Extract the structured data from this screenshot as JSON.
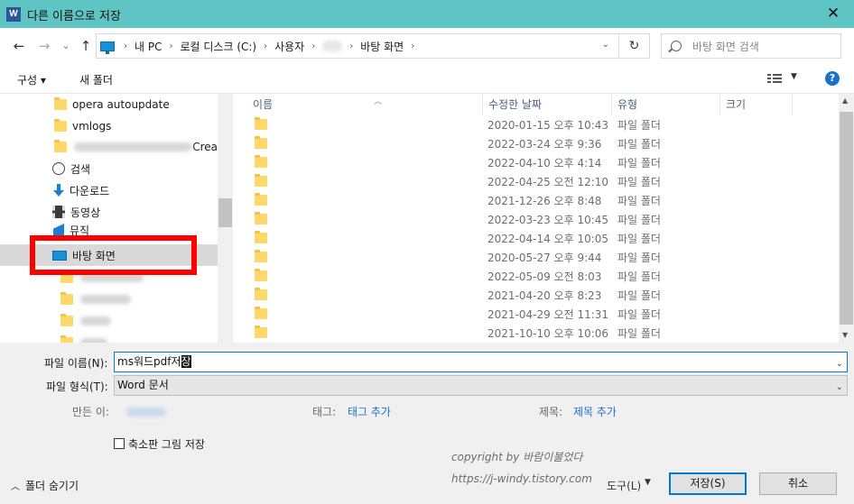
{
  "window": {
    "title": "다른 이름으로 저장",
    "app_icon": "W",
    "close": "✕"
  },
  "nav": {
    "back": "←",
    "forward": "→",
    "recent": "⌄",
    "up": "↑",
    "breadcrumbs": [
      "내 PC",
      "로컬 디스크 (C:)",
      "사용자",
      "바탕 화면"
    ],
    "refresh": "↻",
    "search_placeholder": "바탕 화면 검색"
  },
  "toolbar": {
    "organize": "구성 ▾",
    "new_folder": "새 폴더",
    "help": "?"
  },
  "tree": {
    "items": [
      {
        "label": "opera autoupdate",
        "icon": "folder-icon"
      },
      {
        "label": "vmlogs",
        "icon": "folder-icon"
      },
      {
        "label": "Crea",
        "icon": "folder-icon"
      },
      {
        "label": "검색",
        "icon": "search-icon"
      },
      {
        "label": "다운로드",
        "icon": "download-icon"
      },
      {
        "label": "동영상",
        "icon": "video-icon"
      },
      {
        "label": "뮤직",
        "icon": "music-icon"
      },
      {
        "label": "바탕 화면",
        "icon": "desktop-icon",
        "selected": true
      }
    ]
  },
  "filelist": {
    "columns": [
      "이름",
      "수정한 날짜",
      "유형",
      "크기"
    ],
    "rows": [
      {
        "date": "2020-01-15 오후 10:43",
        "type": "파일 폴더"
      },
      {
        "date": "2022-03-24 오후 9:36",
        "type": "파일 폴더"
      },
      {
        "date": "2022-04-10 오후 4:14",
        "type": "파일 폴더"
      },
      {
        "date": "2022-04-25 오전 12:10",
        "type": "파일 폴더"
      },
      {
        "date": "2021-12-26 오후 8:48",
        "type": "파일 폴더"
      },
      {
        "date": "2022-03-23 오후 10:45",
        "type": "파일 폴더"
      },
      {
        "date": "2022-04-14 오후 10:05",
        "type": "파일 폴더"
      },
      {
        "date": "2020-05-27 오후 9:44",
        "type": "파일 폴더"
      },
      {
        "date": "2022-05-09 오전 8:03",
        "type": "파일 폴더"
      },
      {
        "date": "2021-04-20 오후 8:23",
        "type": "파일 폴더"
      },
      {
        "date": "2021-04-29 오전 11:31",
        "type": "파일 폴더"
      },
      {
        "date": "2021-10-10 오후 10:06",
        "type": "파일 폴더"
      }
    ]
  },
  "form": {
    "filename_label": "파일 이름(N):",
    "filename_value": "ms워드pdf저",
    "filename_selected": "장",
    "filetype_label": "파일 형식(T):",
    "filetype_value": "Word 문서",
    "author_label": "만든 이:",
    "tags_label": "태그:",
    "tags_link": "태그 추가",
    "subject_label": "제목:",
    "subject_link": "제목 추가",
    "thumbnail_label": "축소판 그림 저장",
    "hide_folders": "폴더 숨기기",
    "tools_label": "도구(L)",
    "save_button": "저장(S)",
    "cancel_button": "취소"
  },
  "watermark": {
    "line1": "copyright by 바람이불었다",
    "line2": "https://j-windy.tistory.com"
  }
}
